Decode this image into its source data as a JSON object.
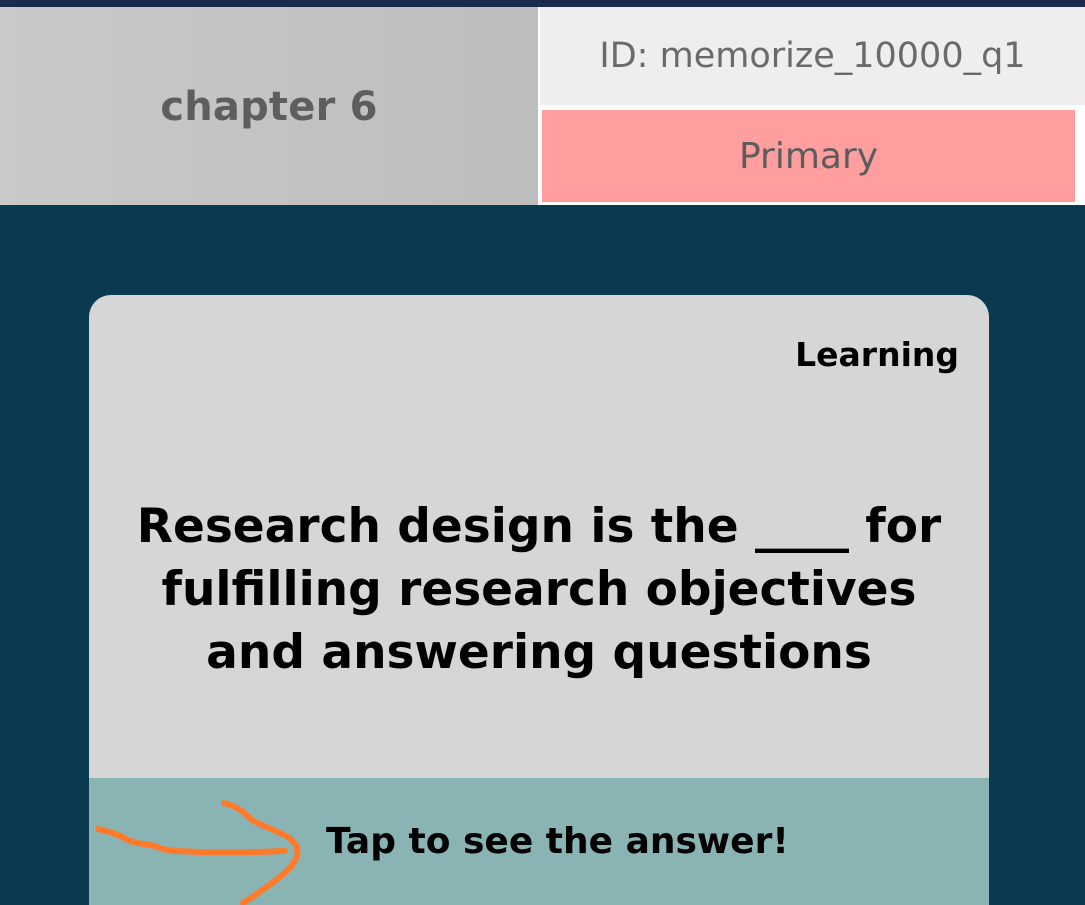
{
  "header": {
    "chapter": "chapter 6",
    "id_label": "ID: memorize_10000_q1",
    "badge": "Primary"
  },
  "card": {
    "mode": "Learning",
    "question": "Research design is the ____ for fulfilling research objectives and answering questions",
    "answer_prompt": "Tap to see the answer!"
  },
  "colors": {
    "background": "#0a3a4f",
    "badge": "#ff9e9e",
    "answer_bar": "#8ab4b4",
    "annotation": "#ff7a2a"
  },
  "icons": {
    "annotation": "hand-drawn-arrow-icon"
  }
}
